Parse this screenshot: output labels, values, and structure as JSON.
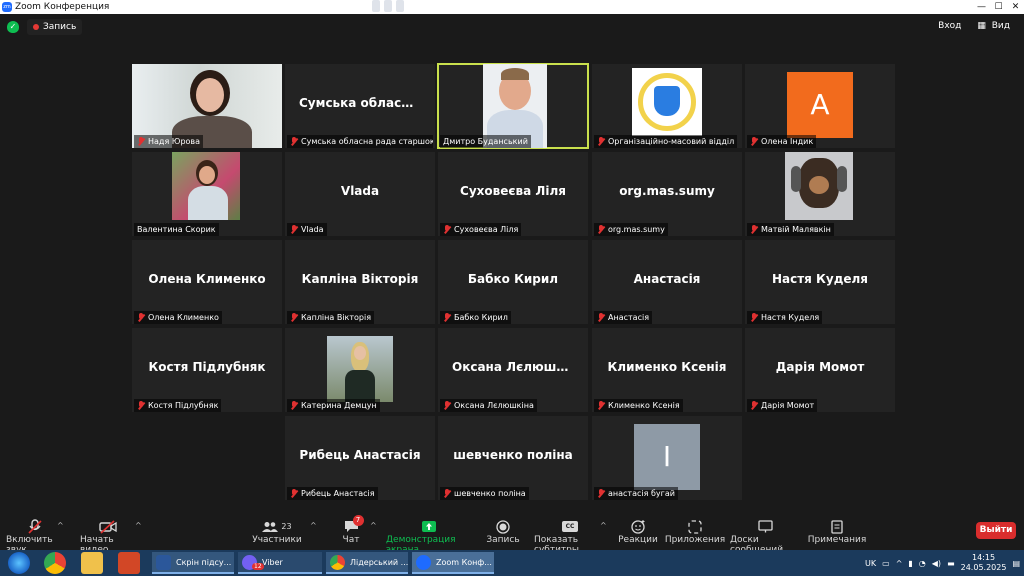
{
  "window": {
    "title": "Zoom Конференция",
    "controls": [
      "—",
      "☐",
      "✕"
    ]
  },
  "topbar": {
    "record_label": "Запись",
    "enter_label": "Вход",
    "view_label": "Вид"
  },
  "tiles": [
    {
      "display": "photo",
      "big": "",
      "tag": "Надя Юрова",
      "muted": true
    },
    {
      "display": "name",
      "big": "Сумська обласна рада старшокласників",
      "tag": "Сумська обласна рада старшокласників",
      "muted": true
    },
    {
      "display": "photo",
      "big": "",
      "tag": "Дмитро Буданський",
      "muted": false
    },
    {
      "display": "photo",
      "big": "",
      "tag": "Організаційно-масовий відділ",
      "muted": true
    },
    {
      "display": "avatar",
      "big": "A",
      "tag": "Олена Індик",
      "muted": true
    },
    {
      "display": "photo",
      "big": "",
      "tag": "Валентина Скорик",
      "muted": false
    },
    {
      "display": "name",
      "big": "Vlada",
      "tag": "Vlada",
      "muted": true
    },
    {
      "display": "name",
      "big": "Суховеєва Ліля",
      "tag": "Суховеєва Ліля",
      "muted": true
    },
    {
      "display": "name",
      "big": "org.mas.sumy",
      "tag": "org.mas.sumy",
      "muted": true
    },
    {
      "display": "photo",
      "big": "",
      "tag": "Матвій Малявкін",
      "muted": true
    },
    {
      "display": "name",
      "big": "Олена Клименко",
      "tag": "Олена Клименко",
      "muted": true
    },
    {
      "display": "name",
      "big": "Капліна Вікторія",
      "tag": "Капліна Вікторія",
      "muted": true
    },
    {
      "display": "name",
      "big": "Бабко Кирил",
      "tag": "Бабко Кирил",
      "muted": true
    },
    {
      "display": "name",
      "big": "Анастасія",
      "tag": "Анастасія",
      "muted": true
    },
    {
      "display": "name",
      "big": "Настя Куделя",
      "tag": "Настя Куделя",
      "muted": true
    },
    {
      "display": "name",
      "big": "Костя Підлубняк",
      "tag": "Костя Підлубняк",
      "muted": true
    },
    {
      "display": "photo",
      "big": "",
      "tag": "Катерина Демцун",
      "muted": true
    },
    {
      "display": "name",
      "big": "Оксана Лєлюшкіна",
      "tag": "Оксана Лєлюшкіна",
      "muted": true
    },
    {
      "display": "name",
      "big": "Клименко Ксенія",
      "tag": "Клименко Ксенія",
      "muted": true
    },
    {
      "display": "name",
      "big": "Дарія Момот",
      "tag": "Дарія Момот",
      "muted": true
    },
    {
      "display": "name",
      "big": "Рибець Анастасія",
      "tag": "Рибець Анастасія",
      "muted": true
    },
    {
      "display": "name",
      "big": "шевченко поліна",
      "tag": "шевченко поліна",
      "muted": true
    },
    {
      "display": "avatar",
      "big": "I",
      "tag": "анастасія бугай",
      "muted": true
    }
  ],
  "toolbar": {
    "mic": "Включить звук",
    "video": "Начать видео",
    "participants": "Участники",
    "participants_count": "23",
    "chat": "Чат",
    "chat_badge": "7",
    "share": "Демонстрация экрана",
    "record": "Запись",
    "cc_icon_text": "CC",
    "captions": "Показать субтитры",
    "reactions": "Реакции",
    "apps": "Приложения",
    "whiteboards": "Доски сообщений",
    "notes": "Примечания",
    "leave": "Выйти"
  },
  "taskbar": {
    "tasks": [
      "Скрін підсу...",
      "Viber",
      "Лідерський ...",
      "Zoom Конф..."
    ],
    "viber_badge": "12",
    "lang": "UK",
    "time": "14:15",
    "date": "24.05.2025"
  },
  "colors": {
    "active_speaker": "#c9e04d",
    "leave": "#d92d2d",
    "share": "#0ebd51",
    "avatar_a": "#f26b1d",
    "avatar_i": "#8e9aa6"
  }
}
